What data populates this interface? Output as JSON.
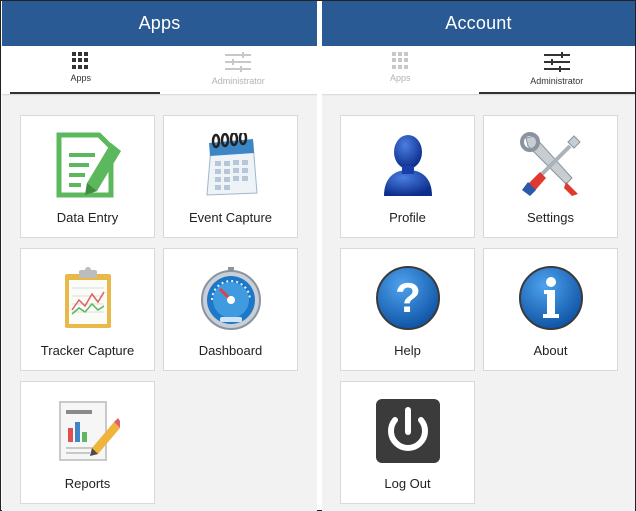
{
  "left_screen": {
    "title": "Apps",
    "tabs": [
      {
        "label": "Apps",
        "icon": "grid-icon",
        "active": true
      },
      {
        "label": "Administrator",
        "icon": "sliders-icon",
        "active": false
      }
    ],
    "tiles": [
      {
        "label": "Data Entry",
        "icon": "data-entry-icon"
      },
      {
        "label": "Event Capture",
        "icon": "calendar-icon"
      },
      {
        "label": "Tracker Capture",
        "icon": "clipboard-chart-icon"
      },
      {
        "label": "Dashboard",
        "icon": "gauge-icon"
      },
      {
        "label": "Reports",
        "icon": "report-icon"
      }
    ]
  },
  "right_screen": {
    "title": "Account",
    "tabs": [
      {
        "label": "Apps",
        "icon": "grid-icon",
        "active": false
      },
      {
        "label": "Administrator",
        "icon": "sliders-icon",
        "active": true
      }
    ],
    "tiles": [
      {
        "label": "Profile",
        "icon": "user-silhouette-icon"
      },
      {
        "label": "Settings",
        "icon": "wrench-screwdriver-icon"
      },
      {
        "label": "Help",
        "icon": "question-icon"
      },
      {
        "label": "About",
        "icon": "info-icon"
      },
      {
        "label": "Log Out",
        "icon": "power-icon"
      }
    ]
  },
  "colors": {
    "appbar": "#2a5a93",
    "tab_active": "#333333",
    "tab_inactive": "#b3b3b3"
  }
}
